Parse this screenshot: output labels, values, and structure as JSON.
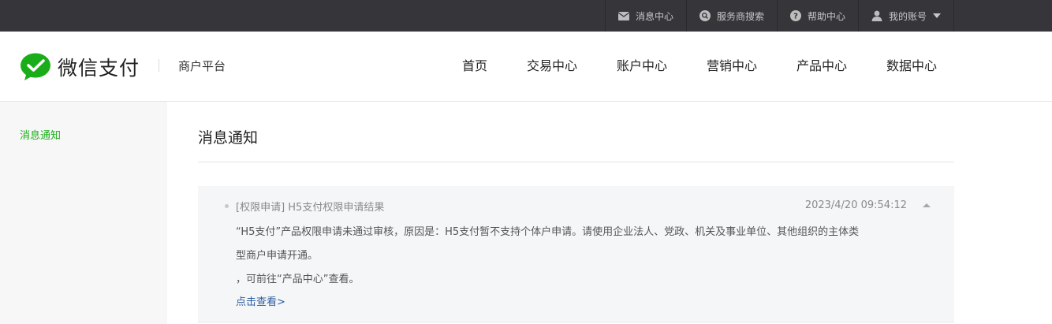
{
  "topbar": {
    "items": [
      {
        "label": "消息中心",
        "icon": "mail-icon"
      },
      {
        "label": "服务商搜索",
        "icon": "search-icon"
      },
      {
        "label": "帮助中心",
        "icon": "help-icon"
      },
      {
        "label": "我的账号",
        "icon": "user-icon"
      }
    ]
  },
  "header": {
    "brand": "微信支付",
    "platform": "商户平台",
    "nav": [
      "首页",
      "交易中心",
      "账户中心",
      "营销中心",
      "产品中心",
      "数据中心"
    ]
  },
  "sidebar": {
    "items": [
      "消息通知"
    ]
  },
  "main": {
    "title": "消息通知",
    "message": {
      "heading": "[权限申请]  H5支付权限申请结果",
      "time": "2023/4/20 09:54:12",
      "lines": [
        "“H5支付”产品权限申请未通过审核，原因是：H5支付暂不支持个体户申请。请使用企业法人、党政、机关及事业单位、其他组织的主体类",
        "型商户申请开通。",
        "，可前往“产品中心”查看。"
      ],
      "link": "点击查看>"
    }
  },
  "colors": {
    "topbar_bg": "#35353a",
    "brand_green": "#1aad19",
    "link_blue": "#2f5e9e",
    "message_bg": "#f4f6f8"
  }
}
